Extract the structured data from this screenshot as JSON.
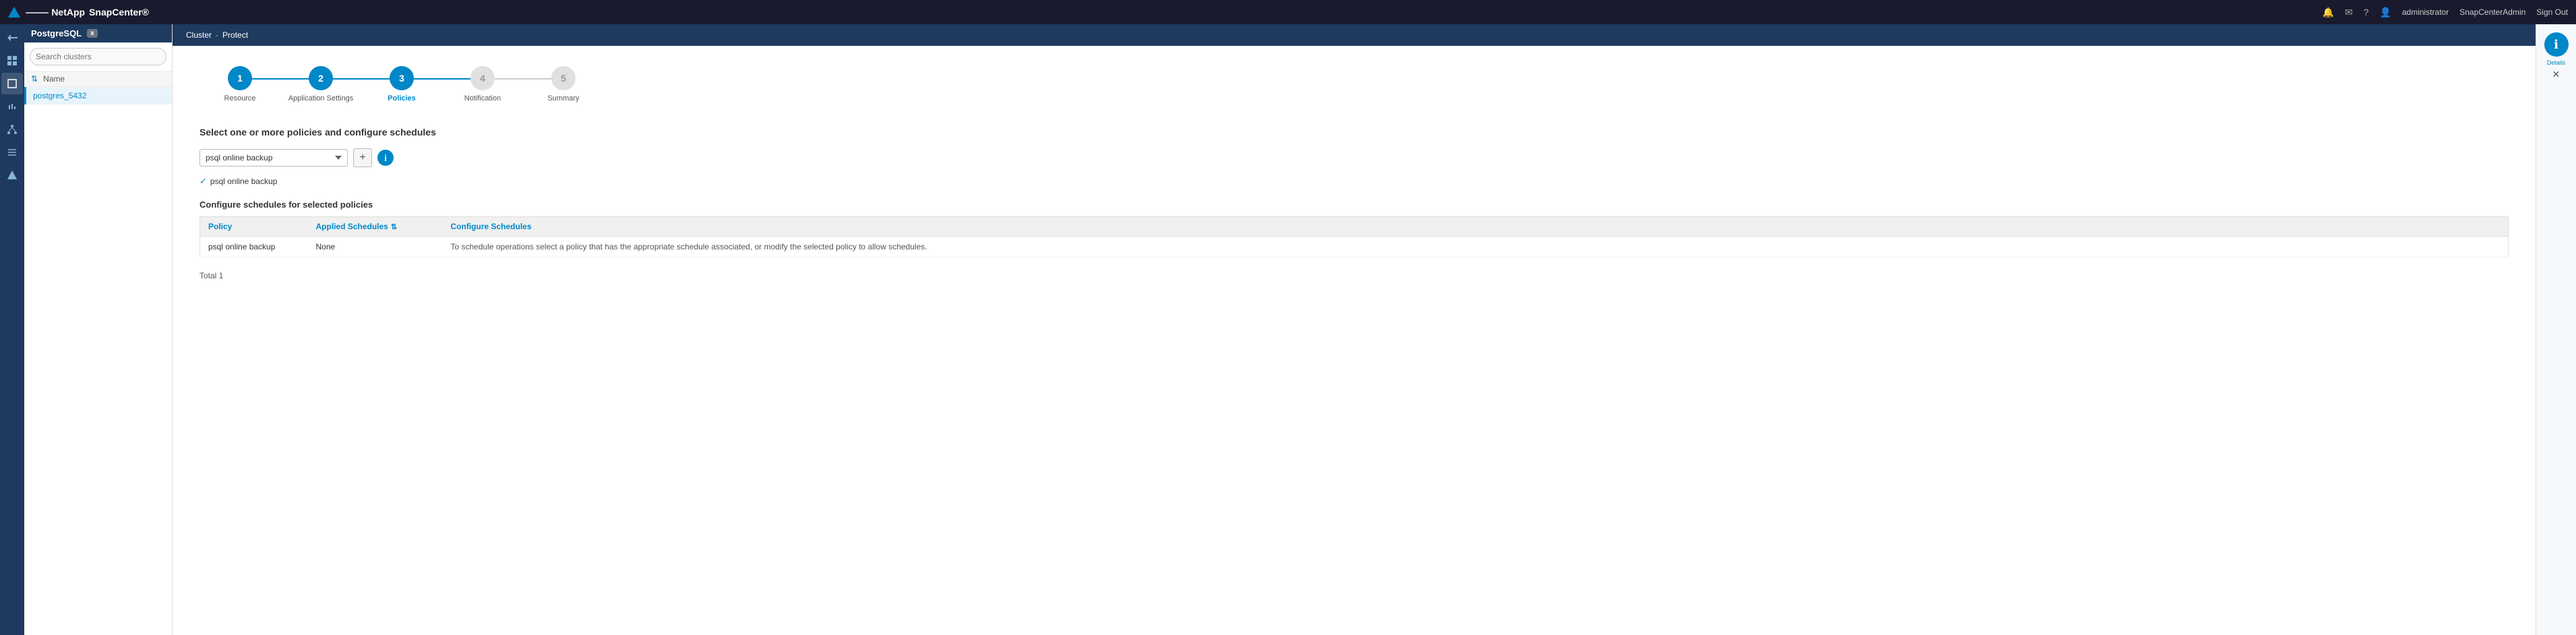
{
  "topNav": {
    "appName": "SnapCenter®",
    "icons": {
      "bell": "🔔",
      "envelope": "✉",
      "help": "?",
      "user": "👤"
    },
    "user": "administrator",
    "instance": "SnapCenterAdmin",
    "signOut": "Sign Out"
  },
  "sidebar": {
    "title": "PostgreSQL",
    "tagLabel": "x",
    "searchPlaceholder": "Search clusters",
    "tableHeader": "Name",
    "items": [
      {
        "label": "postgres_5432"
      }
    ]
  },
  "breadcrumb": {
    "parts": [
      "Cluster",
      "Protect"
    ]
  },
  "stepper": {
    "steps": [
      {
        "number": "1",
        "label": "Resource",
        "state": "done"
      },
      {
        "number": "2",
        "label": "Application Settings",
        "state": "done"
      },
      {
        "number": "3",
        "label": "Policies",
        "state": "active"
      },
      {
        "number": "4",
        "label": "Notification",
        "state": "inactive"
      },
      {
        "number": "5",
        "label": "Summary",
        "state": "inactive"
      }
    ]
  },
  "policies": {
    "sectionTitle": "Select one or more policies and configure schedules",
    "dropdownValue": "psql online backup",
    "dropdownOptions": [
      "psql online backup"
    ],
    "addButtonLabel": "+",
    "selectedPolicy": "psql online backup",
    "configTableTitle": "Configure schedules for selected policies",
    "tableHeaders": {
      "policy": "Policy",
      "appliedSchedules": "Applied Schedules",
      "configureSchedules": "Configure Schedules"
    },
    "tableRows": [
      {
        "policy": "psql online backup",
        "appliedSchedules": "None",
        "configureSchedules": "To schedule operations select a policy that has the appropriate schedule associated, or modify the selected policy to allow schedules."
      }
    ],
    "total": "Total 1"
  },
  "rightPanel": {
    "icon": "ℹ",
    "label": "Details",
    "closeLabel": "✕"
  }
}
